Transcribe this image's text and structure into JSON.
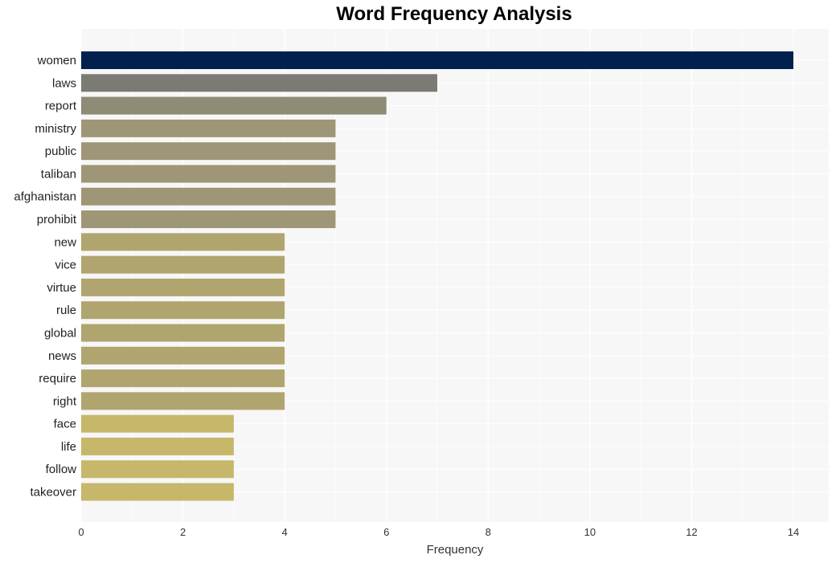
{
  "chart_data": {
    "type": "bar",
    "orientation": "horizontal",
    "title": "Word Frequency Analysis",
    "xlabel": "Frequency",
    "ylabel": "",
    "xlim": [
      0,
      14.7
    ],
    "xticks": [
      0,
      2,
      4,
      6,
      8,
      10,
      12,
      14
    ],
    "grid": true,
    "categories": [
      "women",
      "laws",
      "report",
      "ministry",
      "public",
      "taliban",
      "afghanistan",
      "prohibit",
      "new",
      "vice",
      "virtue",
      "rule",
      "global",
      "news",
      "require",
      "right",
      "face",
      "life",
      "follow",
      "takeover"
    ],
    "values": [
      14,
      7,
      6,
      5,
      5,
      5,
      5,
      5,
      4,
      4,
      4,
      4,
      4,
      4,
      4,
      4,
      3,
      3,
      3,
      3
    ],
    "colors": [
      "#00214d",
      "#7c7a74",
      "#8e8b77",
      "#9e9676",
      "#9e9676",
      "#9e9676",
      "#9e9676",
      "#9e9676",
      "#b1a56f",
      "#b1a56f",
      "#b1a56f",
      "#b1a56f",
      "#b1a56f",
      "#b1a56f",
      "#b1a56f",
      "#b1a56f",
      "#c6b76a",
      "#c6b76a",
      "#c6b76a",
      "#c6b76a"
    ],
    "background": "#f7f7f7"
  }
}
